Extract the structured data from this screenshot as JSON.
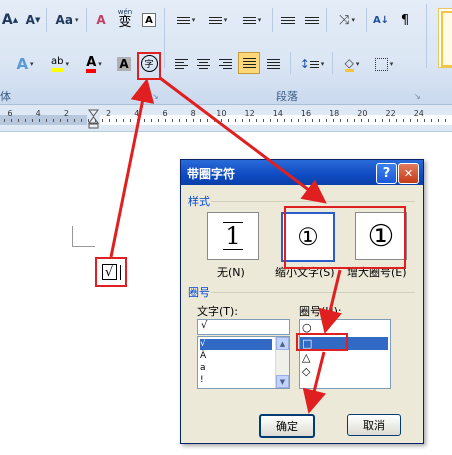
{
  "ribbon": {
    "font_grow": "A",
    "font_shrink": "A",
    "change_case": "Aa",
    "phonetic_guide_icon": "wen-phonetic-icon",
    "phonetic_guide_text": "wén",
    "phonetic_guide_char": "变",
    "char_border": "A",
    "font_color_label": "A",
    "char_shading": "A",
    "enclose_char": "字",
    "group_font_tail": "体",
    "group_paragraph": "段落",
    "accent_color": "#f5c542"
  },
  "ruler": {
    "numbers": [
      "6",
      "4",
      "2",
      "2",
      "4",
      "6",
      "8",
      "10",
      "12",
      "14",
      "16",
      "18",
      "20",
      "22",
      "24"
    ]
  },
  "document": {
    "inserted_char": "√"
  },
  "dialog": {
    "title": "带圈字符",
    "help": "?",
    "close": "✕",
    "style_section": "样式",
    "styles": [
      {
        "label": "无(N)",
        "preview": "1"
      },
      {
        "label": "缩小文字(S)",
        "preview": "①"
      },
      {
        "label": "增大圈号(E)",
        "preview": "①"
      }
    ],
    "enclose_section": "圈号",
    "text_label": "文字(T):",
    "text_value": "√",
    "text_list": [
      "√",
      "À",
      "a",
      "!"
    ],
    "enclosure_label": "圈号(H):",
    "enclosure_list": [
      "○",
      "□",
      "△",
      "◇"
    ],
    "ok": "确定",
    "cancel": "取消"
  }
}
